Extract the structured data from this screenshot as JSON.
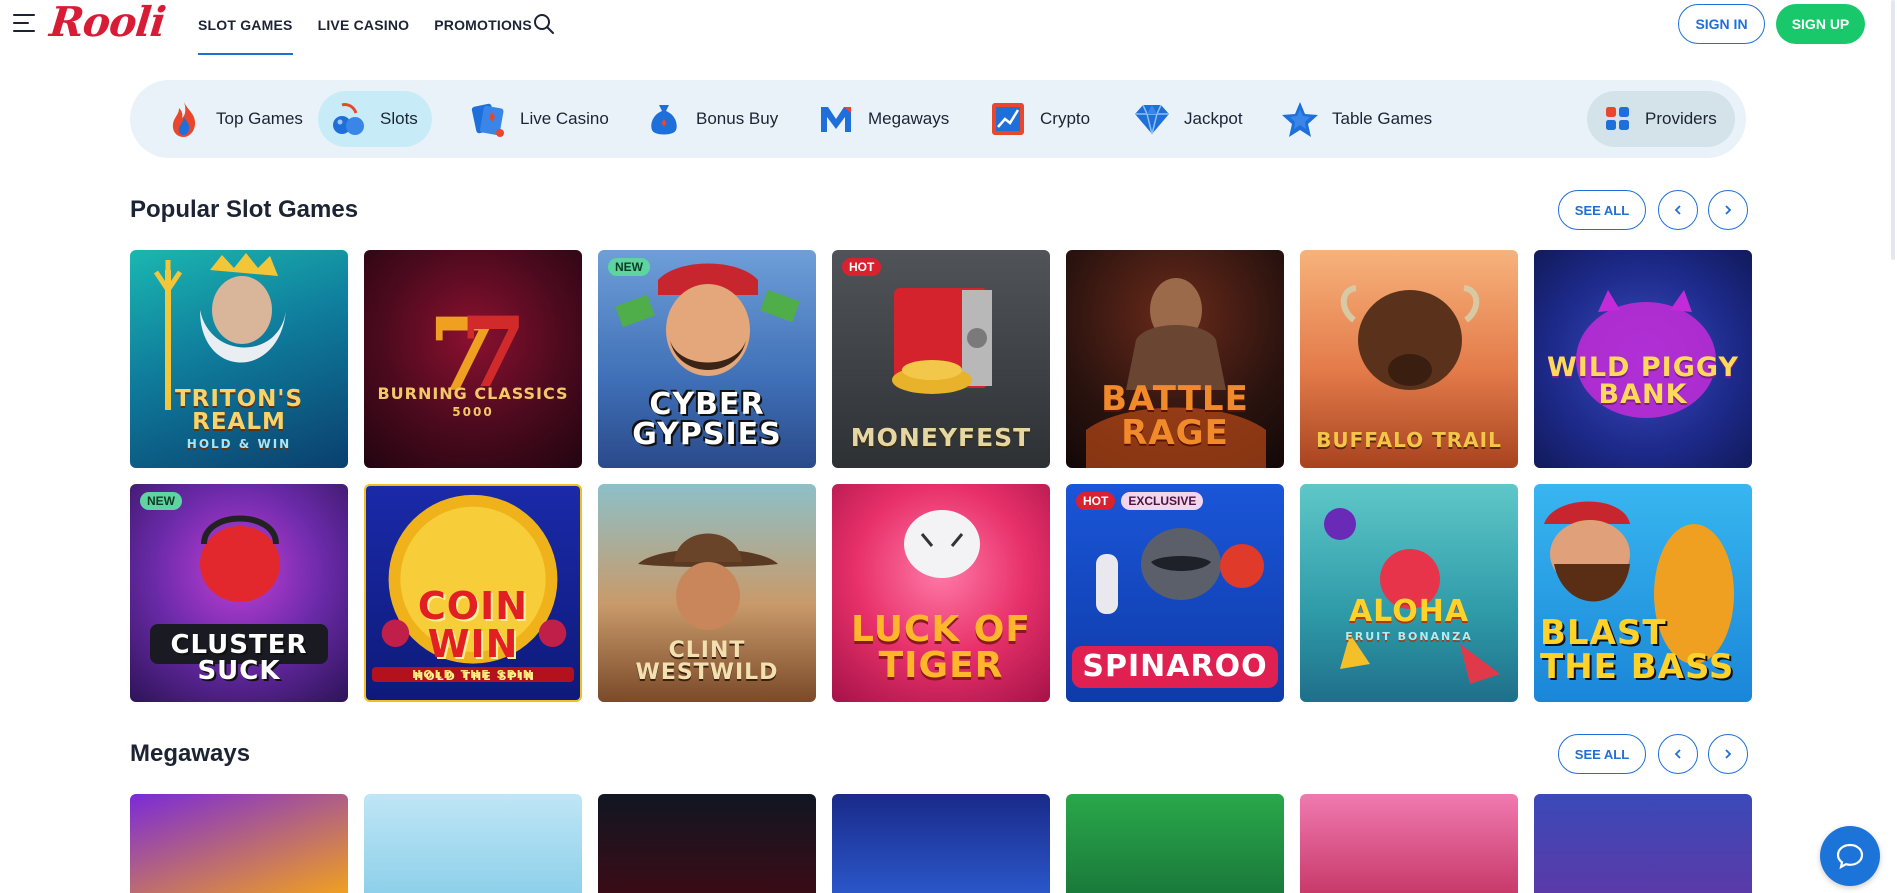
{
  "header": {
    "logo": "Rooli",
    "nav": [
      {
        "label": "SLOT GAMES",
        "active": true
      },
      {
        "label": "LIVE CASINO",
        "active": false
      },
      {
        "label": "PROMOTIONS",
        "active": false
      }
    ],
    "signin_label": "SIGN IN",
    "signup_label": "SIGN UP"
  },
  "categories": [
    {
      "label": "Top Games",
      "icon": "fire-icon"
    },
    {
      "label": "Slots",
      "icon": "cherries-icon",
      "active": true
    },
    {
      "label": "Live Casino",
      "icon": "cards-icon"
    },
    {
      "label": "Bonus Buy",
      "icon": "money-bag-icon"
    },
    {
      "label": "Megaways",
      "icon": "megaways-m-icon"
    },
    {
      "label": "Crypto",
      "icon": "crypto-chart-icon"
    },
    {
      "label": "Jackpot",
      "icon": "diamond-icon"
    },
    {
      "label": "Table Games",
      "icon": "star-icon"
    }
  ],
  "providers_label": "Providers",
  "popular": {
    "title": "Popular Slot Games",
    "see_all": "SEE ALL",
    "games": [
      {
        "title": "TRITON'S REALM",
        "sub": "HOLD & WIN",
        "badges": []
      },
      {
        "title": "BURNING CLASSICS",
        "sub": "5000",
        "badges": []
      },
      {
        "title": "CYBER GYPSIES",
        "sub": "",
        "badges": [
          "NEW"
        ]
      },
      {
        "title": "MONEYFEST",
        "sub": "",
        "badges": [
          "HOT"
        ]
      },
      {
        "title": "BATTLE RAGE",
        "sub": "",
        "badges": []
      },
      {
        "title": "BUFFALO TRAIL",
        "sub": "",
        "badges": []
      },
      {
        "title": "WILD PIGGY BANK",
        "sub": "",
        "badges": []
      },
      {
        "title": "CLUSTER SUCK",
        "sub": "",
        "badges": [
          "NEW"
        ]
      },
      {
        "title": "COIN WIN",
        "sub": "HOLD THE SPIN",
        "badges": []
      },
      {
        "title": "CLINT WESTWILD",
        "sub": "",
        "badges": []
      },
      {
        "title": "LUCK OF TIGER",
        "sub": "",
        "badges": []
      },
      {
        "title": "SPINAROO",
        "sub": "",
        "badges": [
          "HOT",
          "EXCLUSIVE"
        ]
      },
      {
        "title": "ALOHA",
        "sub": "FRUIT BONANZA",
        "badges": []
      },
      {
        "title": "BLAST THE BASS",
        "sub": "",
        "badges": []
      }
    ]
  },
  "megaways": {
    "title": "Megaways",
    "see_all": "SEE ALL"
  },
  "colors": {
    "brand_red": "#d91c35",
    "accent_blue": "#1e6fd9",
    "signup_green": "#19c86a",
    "catbar_bg": "#e9f2f8"
  }
}
